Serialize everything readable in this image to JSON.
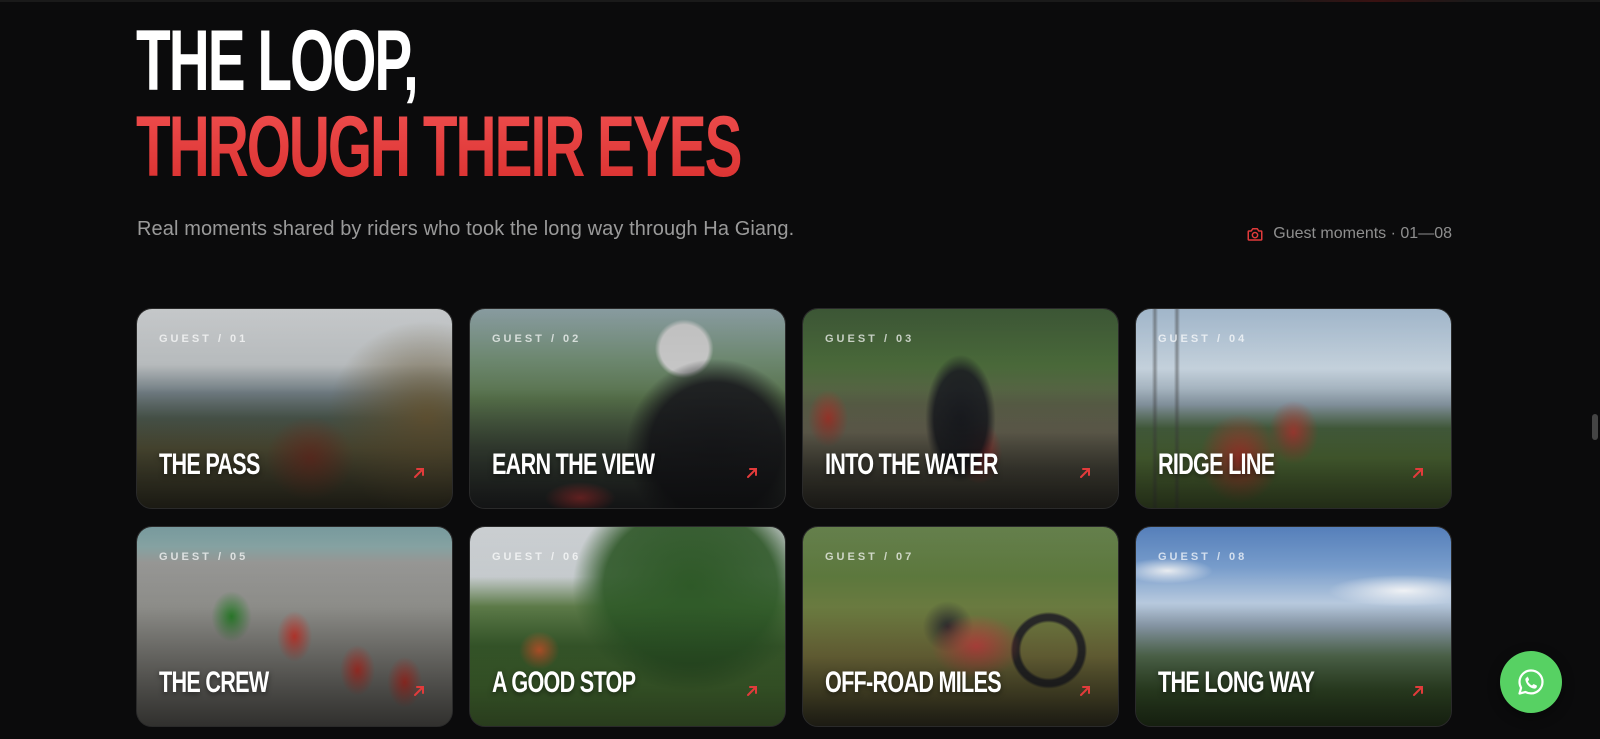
{
  "heading": {
    "line1": "THE LOOP,",
    "line2": "THROUGH THEIR EYES"
  },
  "subtitle": "Real moments shared by riders who took the long way through Ha Giang.",
  "meta": {
    "icon": "camera-icon",
    "label": "Guest moments · 01—08"
  },
  "colors": {
    "accent": "#e23b3b",
    "background": "#0b0b0c",
    "whatsapp": "#57d163"
  },
  "cards": [
    {
      "tag": "GUEST / 01",
      "title": "THE PASS"
    },
    {
      "tag": "GUEST / 02",
      "title": "EARN THE VIEW"
    },
    {
      "tag": "GUEST / 03",
      "title": "INTO THE WATER"
    },
    {
      "tag": "GUEST / 04",
      "title": "RIDGE LINE"
    },
    {
      "tag": "GUEST / 05",
      "title": "THE CREW"
    },
    {
      "tag": "GUEST / 06",
      "title": "A GOOD STOP"
    },
    {
      "tag": "GUEST / 07",
      "title": "OFF-ROAD MILES"
    },
    {
      "tag": "GUEST / 08",
      "title": "THE LONG WAY"
    }
  ],
  "whatsapp": {
    "icon": "whatsapp-icon"
  }
}
